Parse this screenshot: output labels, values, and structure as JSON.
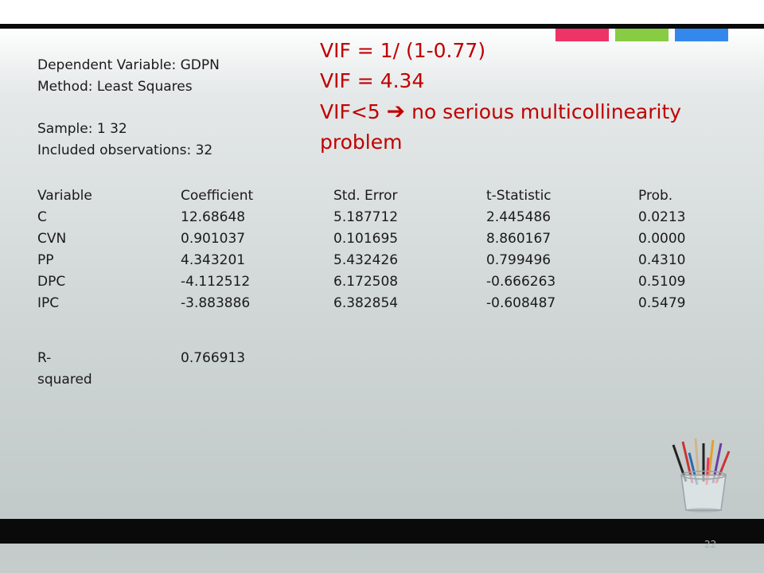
{
  "header": {
    "accent_colors": [
      "#ee3366",
      "#88cc44",
      "#3388ee"
    ]
  },
  "meta": {
    "line1": "Dependent Variable: GDPN",
    "line2": "Method: Least Squares",
    "line3": "Sample: 1 32",
    "line4": "Included observations: 32"
  },
  "vif": {
    "line1": "VIF = 1/ (1-0.77)",
    "line2": "VIF = 4.34",
    "line3_prefix": "VIF<5",
    "line3_suffix": "no serious multicollinearity problem"
  },
  "table": {
    "headers": [
      "Variable",
      "Coefficient",
      "Std. Error",
      "t-Statistic",
      "Prob."
    ],
    "rows": [
      [
        "C",
        "12.68648",
        "5.187712",
        "2.445486",
        "0.0213"
      ],
      [
        "CVN",
        "0.901037",
        "0.101695",
        "8.860167",
        "0.0000"
      ],
      [
        "PP",
        "4.343201",
        "5.432426",
        "0.799496",
        "0.4310"
      ],
      [
        "DPC",
        "-4.112512",
        "6.172508",
        "-0.666263",
        "0.5109"
      ],
      [
        "IPC",
        "-3.883886",
        "6.382854",
        "-0.608487",
        "0.5479"
      ]
    ]
  },
  "rsquared": {
    "label": "R-squared",
    "value": "0.766913"
  },
  "footer": {
    "page_number": "22"
  }
}
